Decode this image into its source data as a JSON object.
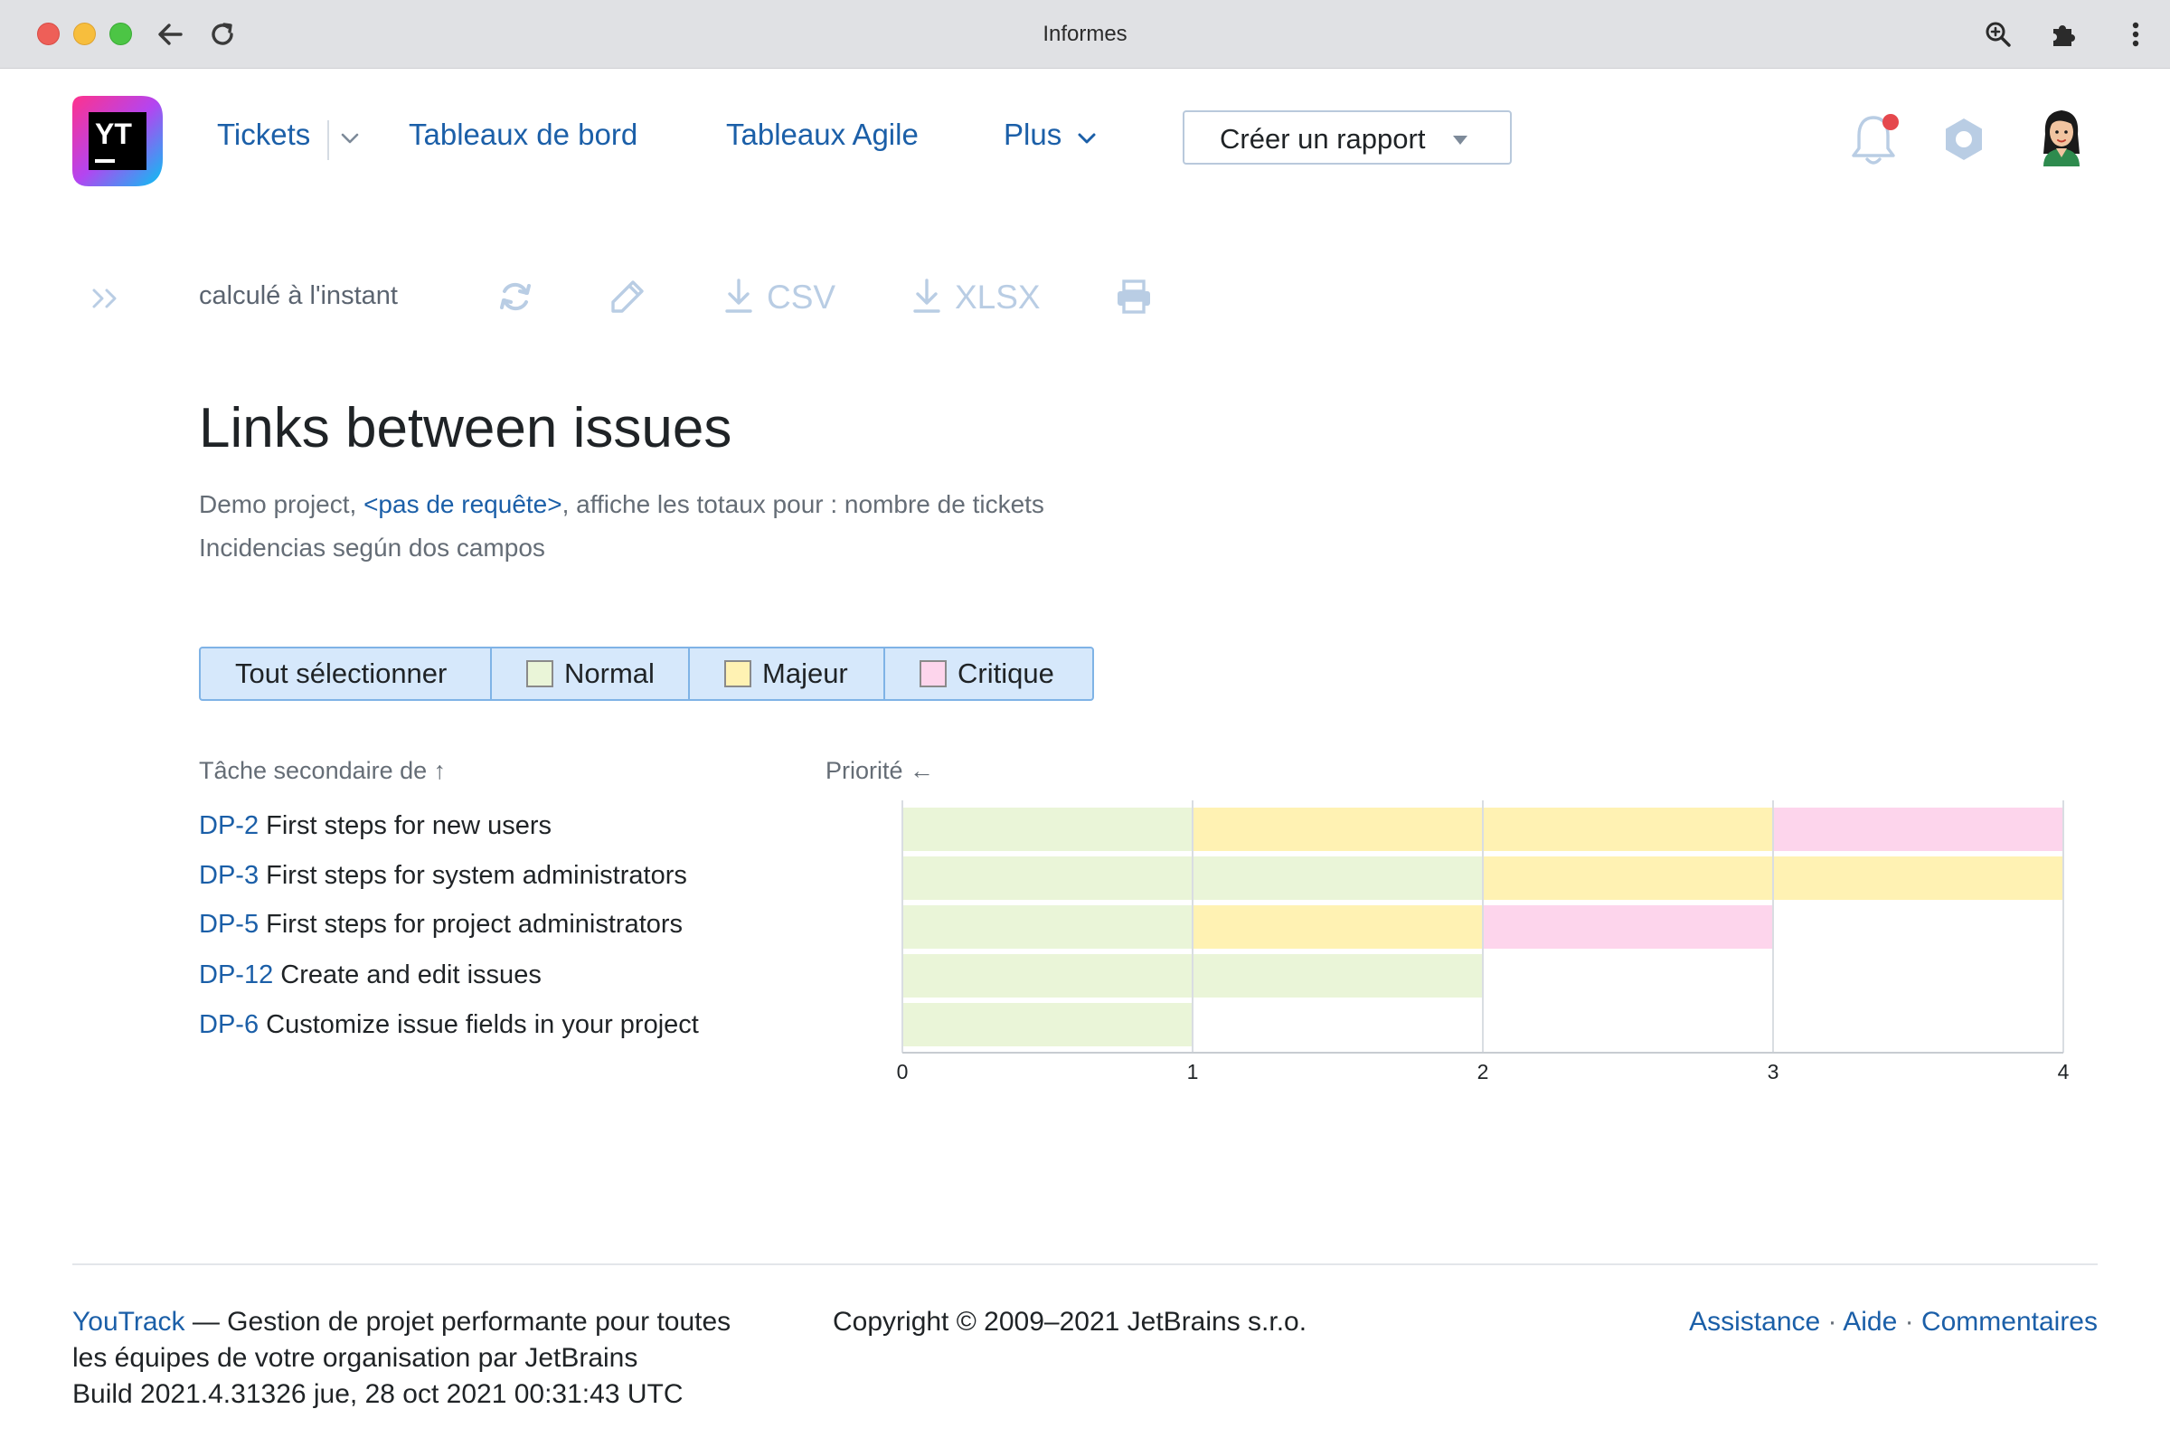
{
  "window": {
    "title": "Informes"
  },
  "header": {
    "nav": {
      "tickets": "Tickets",
      "dashboards": "Tableaux de bord",
      "agile_boards": "Tableaux Agile",
      "more": "Plus"
    },
    "create_report": "Créer un rapport",
    "notification_badge_color": "#e5484d"
  },
  "toolbar": {
    "calculated": "calculé à l'instant",
    "csv": "CSV",
    "xlsx": "XLSX"
  },
  "report": {
    "title": "Links between issues",
    "subtitle_project": "Demo project, ",
    "subtitle_query": "<pas de requête>",
    "subtitle_rest": ", affiche les totaux pour : nombre de tickets",
    "description": "Incidencias según dos campos"
  },
  "legend": {
    "select_all": "Tout sélectionner",
    "items": [
      {
        "label": "Normal",
        "color": "#eaf5d8"
      },
      {
        "label": "Majeur",
        "color": "#fff2b3"
      },
      {
        "label": "Critique",
        "color": "#fdd5ec"
      }
    ]
  },
  "columns": {
    "subtask": "Tâche secondaire de ↑",
    "priority": "Priorité ←"
  },
  "rows": [
    {
      "id": "DP-2",
      "summary": " First steps for new users"
    },
    {
      "id": "DP-3",
      "summary": " First steps for system administrators"
    },
    {
      "id": "DP-5",
      "summary": " First steps for project administrators"
    },
    {
      "id": "DP-12",
      "summary": " Create and edit issues"
    },
    {
      "id": "DP-6",
      "summary": " Customize issue fields in your project"
    }
  ],
  "chart_data": {
    "type": "bar",
    "orientation": "horizontal",
    "stacked": true,
    "categories": [
      "DP-2",
      "DP-3",
      "DP-5",
      "DP-12",
      "DP-6"
    ],
    "series": [
      {
        "name": "Normal",
        "color": "#eaf5d8",
        "values": [
          1,
          2,
          1,
          2,
          1
        ]
      },
      {
        "name": "Majeur",
        "color": "#fff2b3",
        "values": [
          2,
          2,
          1,
          0,
          0
        ]
      },
      {
        "name": "Critique",
        "color": "#fdd5ec",
        "values": [
          1,
          0,
          1,
          0,
          0
        ]
      }
    ],
    "x_ticks": [
      "0",
      "1",
      "2",
      "3",
      "4"
    ],
    "xlim": [
      0,
      4
    ],
    "grid": true
  },
  "footer": {
    "youtrack": "YouTrack",
    "tagline": " — Gestion de projet performante pour toutes les équipes de votre organisation par JetBrains",
    "build": "Build 2021.4.31326 jue, 28 oct 2021 00:31:43 UTC",
    "copyright": "Copyright © 2009–2021 JetBrains s.r.o.",
    "links": {
      "support": "Assistance",
      "help": "Aide",
      "feedback": "Commentaires",
      "separator": " · "
    }
  }
}
